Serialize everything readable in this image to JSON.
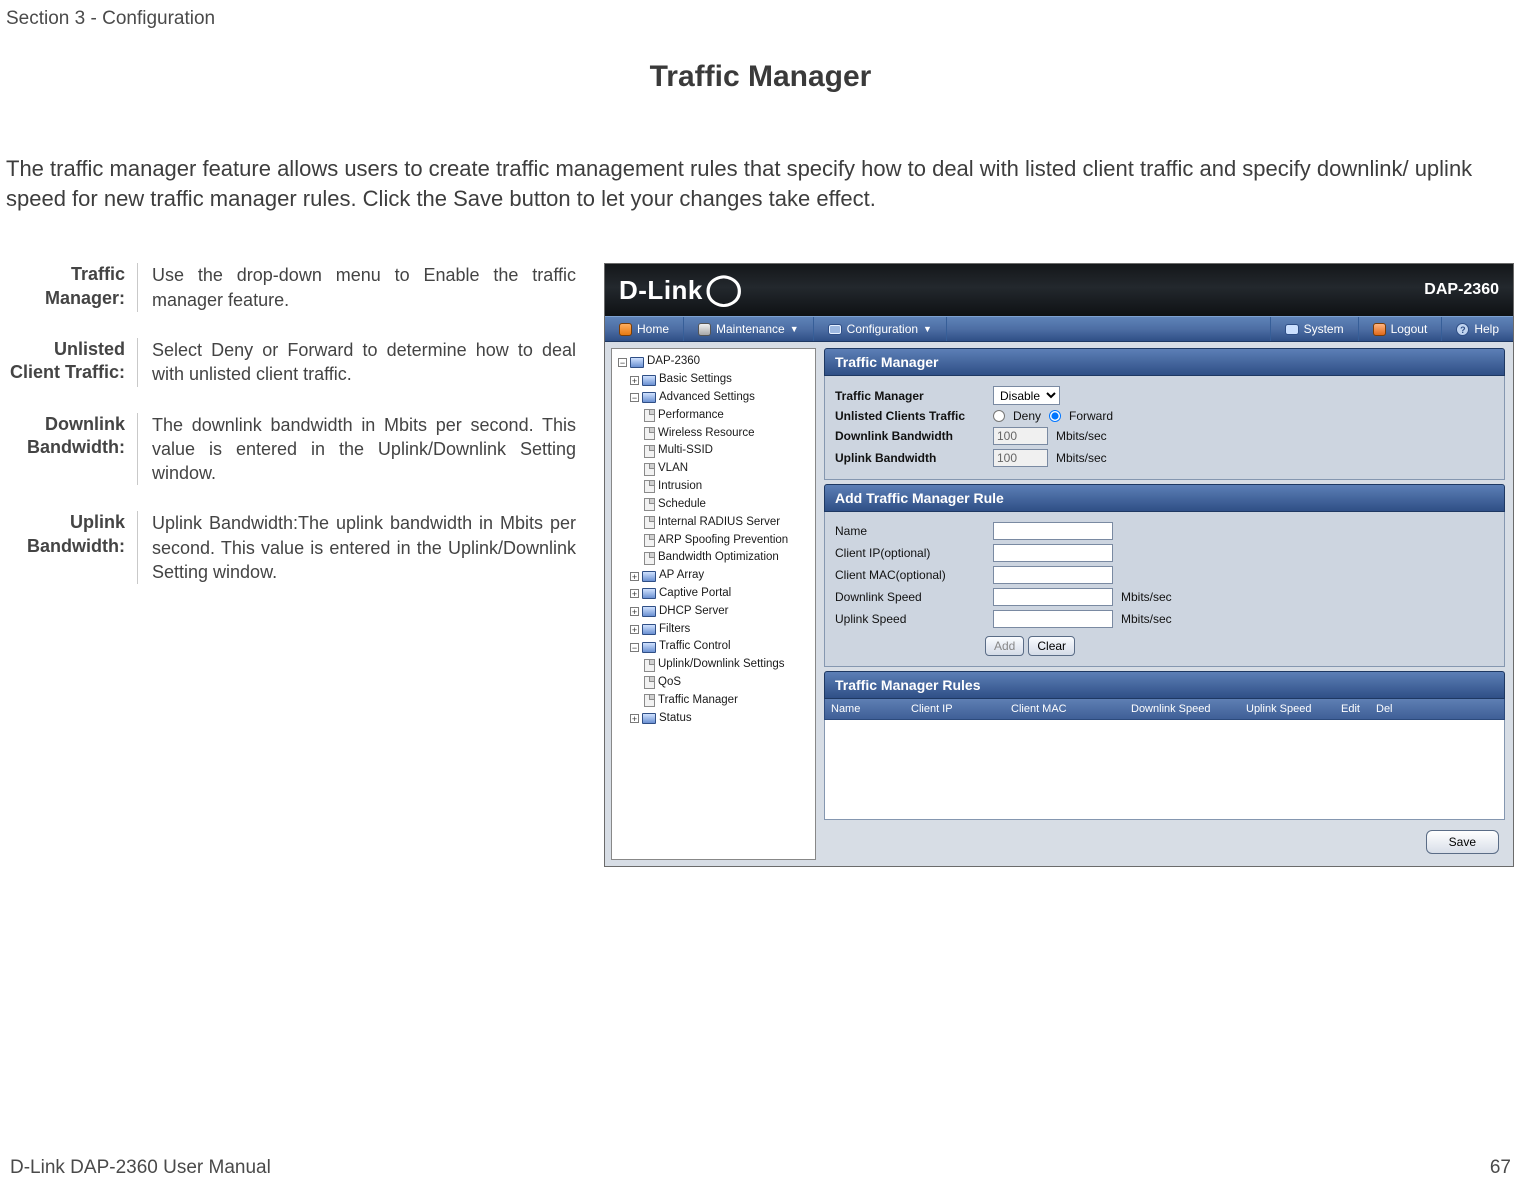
{
  "section_header": "Section 3 - Configuration",
  "page_title": "Traffic Manager",
  "intro": "The traffic manager feature allows users to create traffic management rules that specify how to deal with listed client traffic and specify downlink/ uplink speed for new traffic manager rules. Click the Save button to let your changes take effect.",
  "definitions": [
    {
      "label": "Traffic Manager:",
      "value": "Use the drop-down menu to Enable the traffic manager feature."
    },
    {
      "label": "Unlisted Client Traffic:",
      "value": "Select Deny or Forward to determine how to deal with unlisted client traffic."
    },
    {
      "label": "Downlink Bandwidth:",
      "value": "The downlink bandwidth in Mbits per second. This value is entered in the Uplink/Downlink Setting window."
    },
    {
      "label": "Uplink Bandwidth:",
      "value": "Uplink Bandwidth:The uplink bandwidth in Mbits per second. This value is entered in the Uplink/Downlink Setting window."
    }
  ],
  "ui": {
    "brand": "D-Link",
    "model": "DAP-2360",
    "menubar": {
      "home": "Home",
      "maintenance": "Maintenance",
      "configuration": "Configuration",
      "system": "System",
      "logout": "Logout",
      "help": "Help"
    },
    "tree": {
      "root": "DAP-2360",
      "basic": "Basic Settings",
      "advanced": "Advanced Settings",
      "adv_items": [
        "Performance",
        "Wireless Resource",
        "Multi-SSID",
        "VLAN",
        "Intrusion",
        "Schedule",
        "Internal RADIUS Server",
        "ARP Spoofing Prevention",
        "Bandwidth Optimization"
      ],
      "ap_array": "AP Array",
      "captive": "Captive Portal",
      "dhcp": "DHCP Server",
      "filters": "Filters",
      "traffic_control": "Traffic Control",
      "tc_items": [
        "Uplink/Downlink Settings",
        "QoS",
        "Traffic Manager"
      ],
      "status": "Status"
    },
    "panel": {
      "title": "Traffic Manager",
      "traffic_manager_label": "Traffic Manager",
      "traffic_manager_value": "Disable",
      "unlisted_label": "Unlisted Clients Traffic",
      "deny": "Deny",
      "forward": "Forward",
      "downlink_bw_label": "Downlink Bandwidth",
      "downlink_bw_value": "100",
      "unit": "Mbits/sec",
      "uplink_bw_label": "Uplink Bandwidth",
      "uplink_bw_value": "100",
      "add_rule_title": "Add Traffic Manager Rule",
      "name_label": "Name",
      "client_ip_label": "Client IP(optional)",
      "client_mac_label": "Client MAC(optional)",
      "downlink_speed_label": "Downlink Speed",
      "uplink_speed_label": "Uplink Speed",
      "add_btn": "Add",
      "clear_btn": "Clear",
      "rules_title": "Traffic Manager Rules",
      "rules_cols": {
        "name": "Name",
        "client_ip": "Client IP",
        "client_mac": "Client MAC",
        "downlink": "Downlink Speed",
        "uplink": "Uplink Speed",
        "edit": "Edit",
        "del": "Del"
      },
      "save_btn": "Save"
    }
  },
  "footer": {
    "left": "D-Link DAP-2360 User Manual",
    "right": "67"
  }
}
